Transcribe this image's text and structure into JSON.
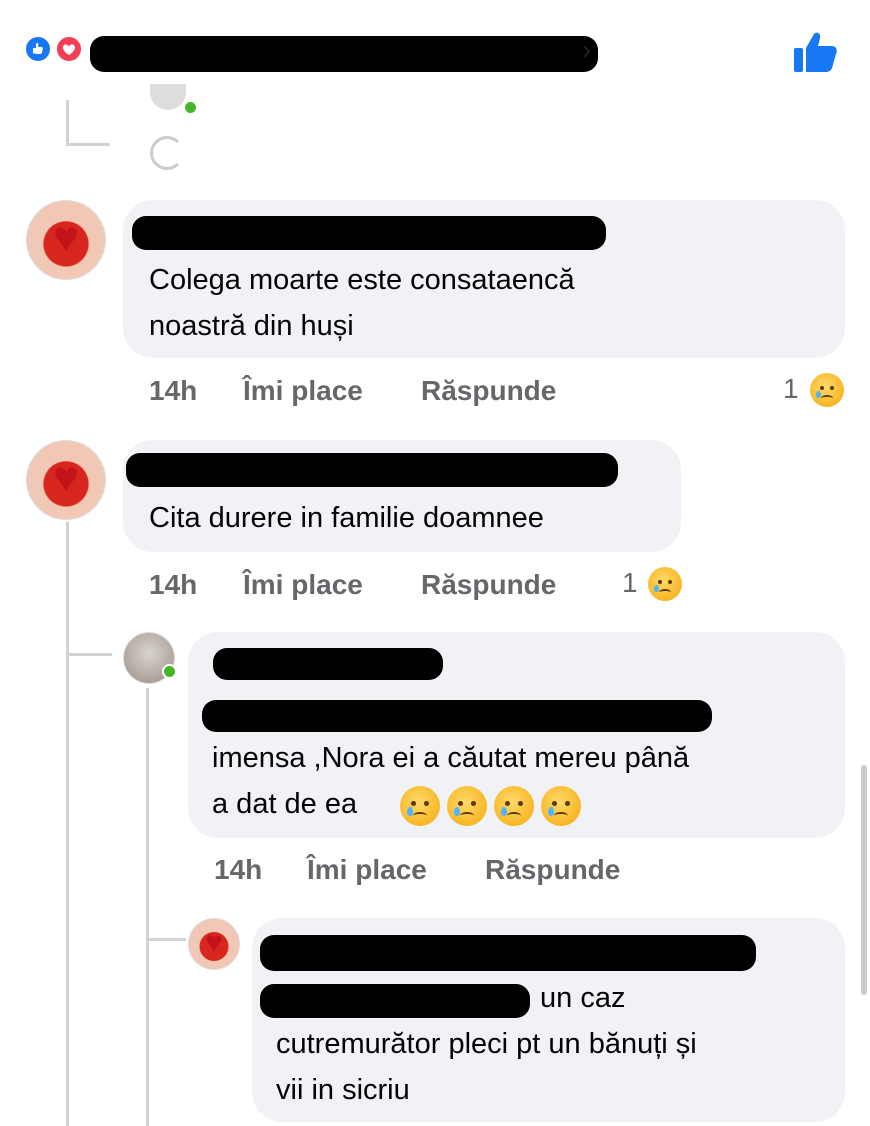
{
  "header": {
    "like_icon": "like-icon",
    "love_icon": "love-icon",
    "chevron": "›",
    "thumb_icon": "thumbs-up-icon",
    "accent": "#1877f2"
  },
  "comments": [
    {
      "text_line1": "Colega moarte este consataencă",
      "text_line2": "noastră  din huși",
      "time": "14h",
      "like": "Îmi place",
      "reply": "Răspunde",
      "reaction_count": "1"
    },
    {
      "text_line1": "Cita durere in familie doamnee",
      "time": "14h",
      "like": "Îmi place",
      "reply": "Răspunde",
      "reaction_count": "1"
    },
    {
      "text_line1": "imensa ,Nora ei a căutat mereu până",
      "text_line2": "a dat de ea",
      "time": "14h",
      "like": "Îmi place",
      "reply": "Răspunde"
    },
    {
      "text_line1": "un caz",
      "text_line2": "cutremurător pleci pt un bănuți și",
      "text_line3": "vii in sicriu"
    }
  ]
}
